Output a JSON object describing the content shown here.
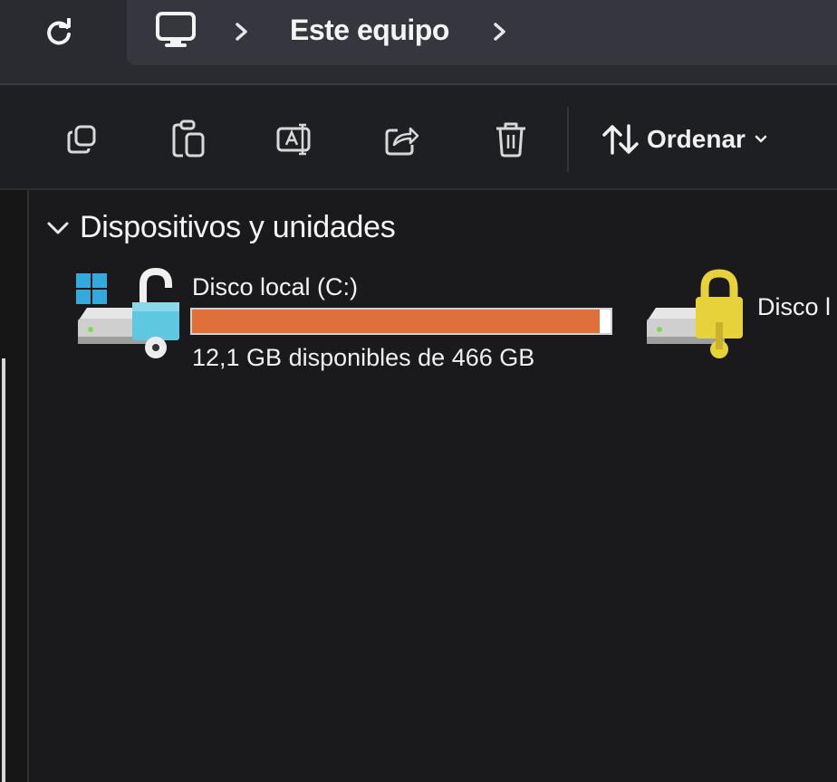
{
  "address_bar": {
    "location": "Este equipo",
    "separator": ">"
  },
  "toolbar": {
    "buttons": [
      {
        "name": "copy",
        "icon": "copy-icon"
      },
      {
        "name": "paste",
        "icon": "paste-icon"
      },
      {
        "name": "rename",
        "icon": "rename-icon"
      },
      {
        "name": "share",
        "icon": "share-icon"
      },
      {
        "name": "delete",
        "icon": "trash-icon"
      }
    ],
    "sort_label": "Ordenar"
  },
  "section": {
    "title": "Dispositivos y unidades",
    "expanded": true
  },
  "drives": [
    {
      "name": "Disco local (C:)",
      "free_text": "12,1 GB disponibles de 466 GB",
      "used_fraction": 0.974,
      "bar_color": "#e0703a",
      "lock": "unlocked"
    },
    {
      "name": "Disco l",
      "lock": "locked"
    }
  ],
  "colors": {
    "background": "#1a1a1c",
    "address_bar": "#35363e",
    "usage_bar": "#e0703a",
    "lock_gold": "#e8d23c",
    "lock_blue": "#5fc8e0"
  }
}
